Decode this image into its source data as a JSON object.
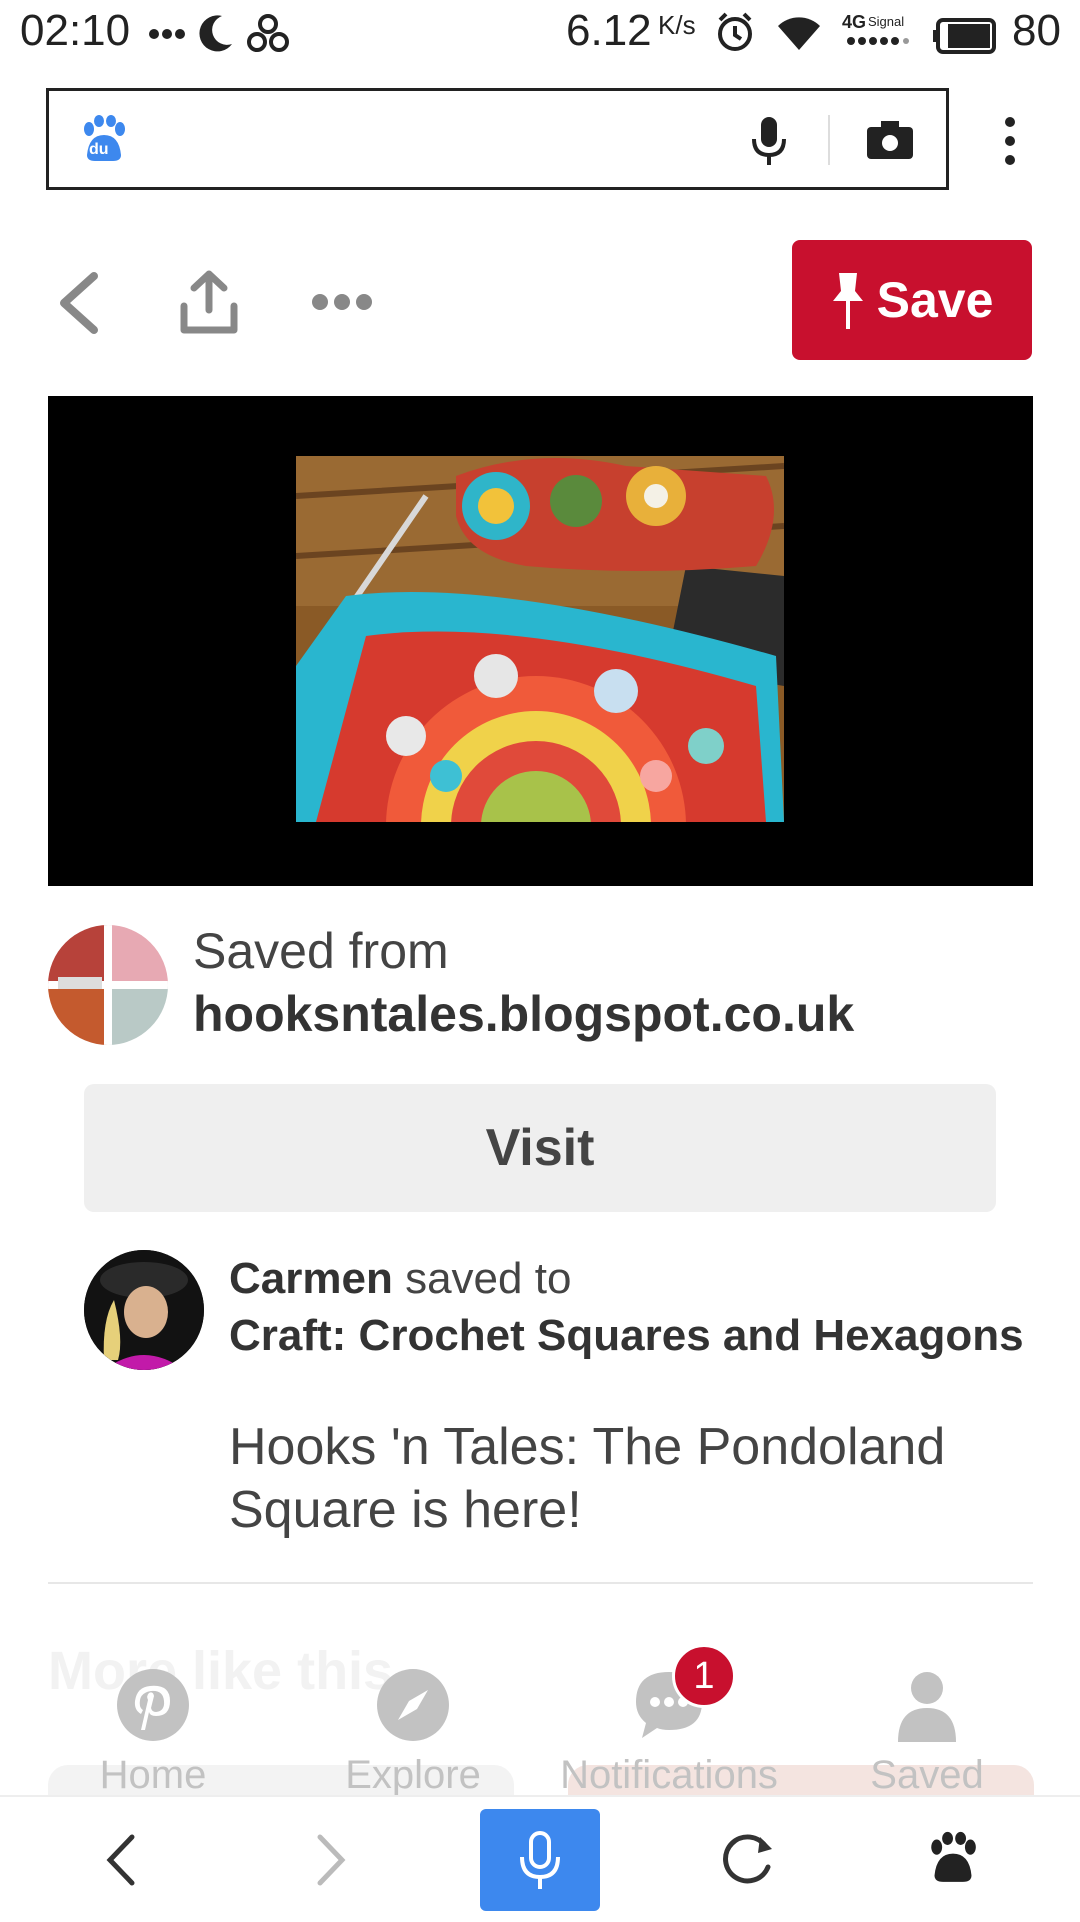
{
  "status_bar": {
    "time": "02:10",
    "speed_value": "6.12",
    "speed_unit": "K/s",
    "network": "4G",
    "signal_label": "Signal",
    "battery": "80"
  },
  "browser": {
    "search_placeholder": "",
    "search_logo_text": "du"
  },
  "pin": {
    "save_label": "Save",
    "saved_from_label": "Saved from",
    "source_domain": "hooksntales.blogspot.co.uk",
    "visit_label": "Visit",
    "pinner_name": "Carmen",
    "saved_to_text": "saved to",
    "board_name": "Craft: Crochet Squares and Hexagons",
    "description": "Hooks 'n Tales: The Pondoland Square is here!"
  },
  "more_like_this": "More like this",
  "tabs": [
    {
      "label": "Home",
      "icon": "pinterest-icon"
    },
    {
      "label": "Explore",
      "icon": "compass-icon"
    },
    {
      "label": "Notifications",
      "icon": "chat-bubble-icon",
      "badge": "1"
    },
    {
      "label": "Saved",
      "icon": "person-icon"
    }
  ],
  "colors": {
    "save_red": "#c8102e",
    "browser_blue": "#3d88ee",
    "visit_gray": "#efefef"
  }
}
